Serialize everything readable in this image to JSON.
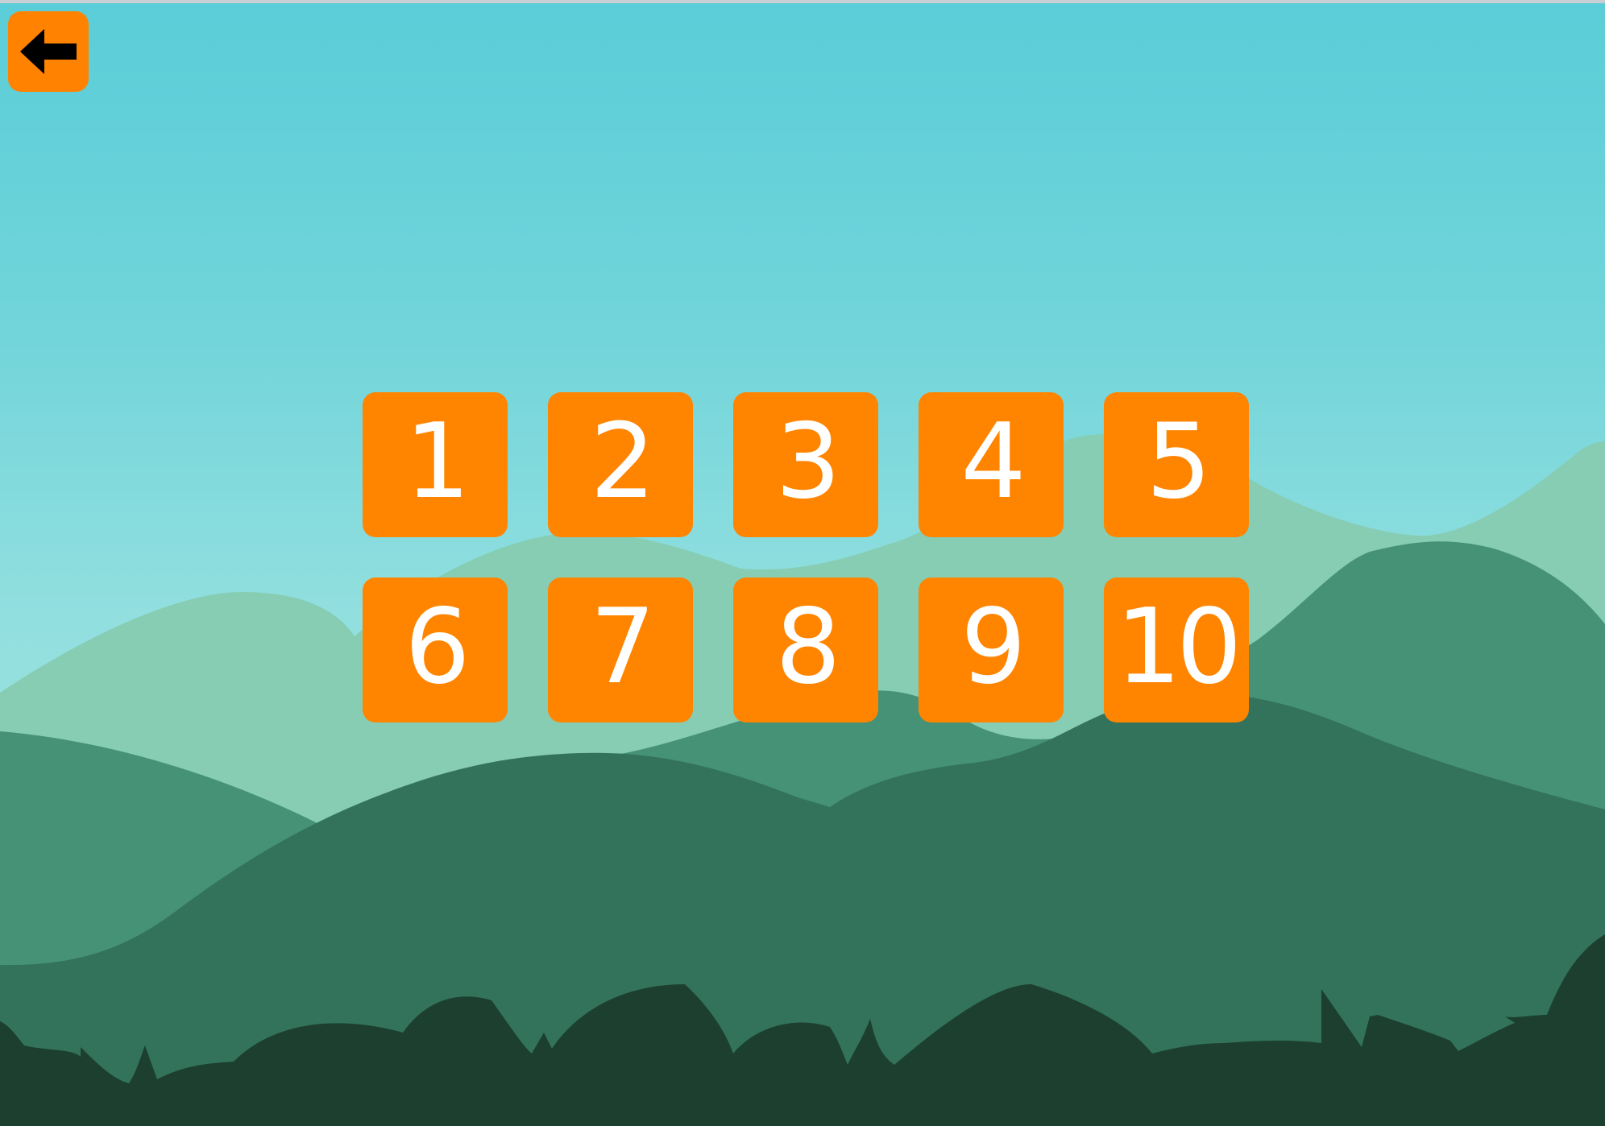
{
  "back_button": {
    "icon": "arrow-left-icon",
    "color": "#ff8200"
  },
  "levels": [
    {
      "label": "1"
    },
    {
      "label": "2"
    },
    {
      "label": "3"
    },
    {
      "label": "4"
    },
    {
      "label": "5"
    },
    {
      "label": "6"
    },
    {
      "label": "7"
    },
    {
      "label": "8"
    },
    {
      "label": "9"
    },
    {
      "label": "10"
    }
  ],
  "colors": {
    "tile": "#ff8500",
    "sky_top": "#5acdd8",
    "sky_bottom": "#a6e5e0",
    "hill_far": "#87cdb3",
    "hill_mid": "#469276",
    "hill_near": "#33735b",
    "foreground": "#1c3f30"
  }
}
